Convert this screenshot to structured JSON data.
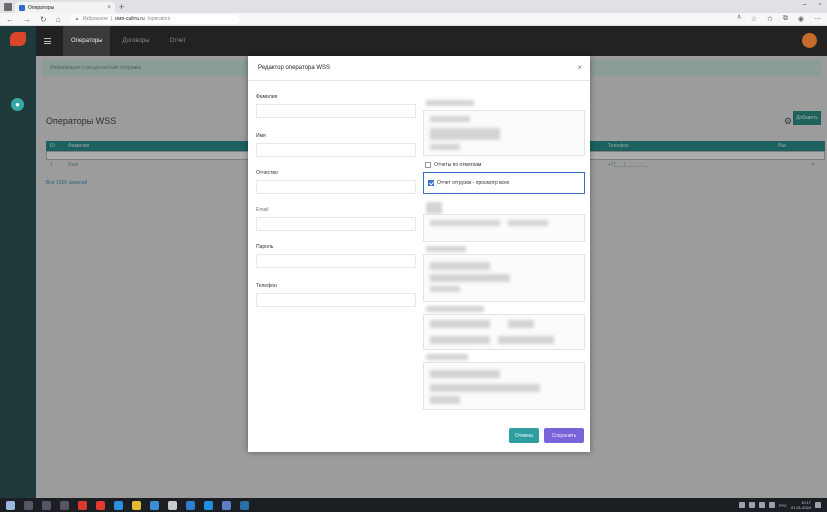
{
  "browser": {
    "tab_title": "Операторы",
    "tab_close": "×",
    "new_tab": "+",
    "url_bookmark": "Избранное",
    "url_domain": "имя-сайта.ru",
    "url_path": "/operators"
  },
  "nav": {
    "items": [
      "Операторы",
      "Договоры",
      "Отчет"
    ]
  },
  "page": {
    "info": "Информация о ресурсах/сайт отправки",
    "title": "Операторы WSS",
    "add_button": "Добавить",
    "columns": [
      "ID",
      "Фамилия",
      "",
      "Телефон",
      "Раз"
    ],
    "row": [
      "1",
      "Фам",
      "",
      "+7(___)___-__-__",
      "✎"
    ],
    "footer_link": "Все 1000 записей"
  },
  "modal": {
    "title": "Редактор оператора WSS",
    "close": "×",
    "fields": {
      "lastname": "Фамилия",
      "firstname": "Имя",
      "middlename": "Отчество",
      "email": "Email",
      "password": "Пароль",
      "phone": "Телефон"
    },
    "permissions": {
      "reports_label": "Отчеты по отметкам",
      "reports_checked": false,
      "shipment_label": "Отчет отгрузок - просмотр всех",
      "shipment_checked": true
    },
    "cancel": "Отмена",
    "save": "Сохранить"
  },
  "taskbar": {
    "time": "10:17",
    "date": "01.01.2024",
    "lang": "РУС"
  }
}
